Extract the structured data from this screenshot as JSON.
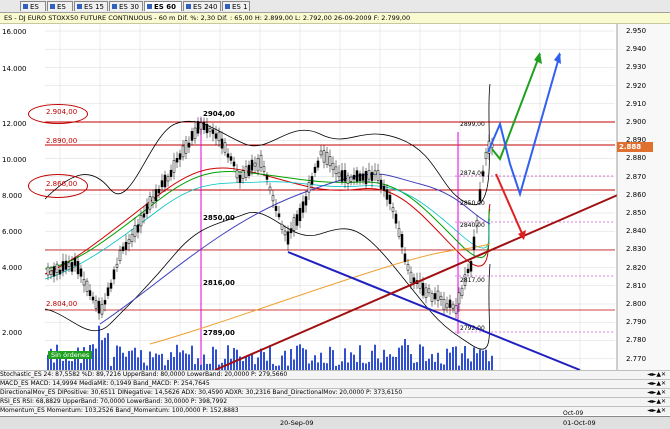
{
  "tabs": [
    {
      "label": "ES 1 m",
      "active": false
    },
    {
      "label": "ES 5 m",
      "active": false
    },
    {
      "label": "ES 15 m",
      "active": false
    },
    {
      "label": "ES 30 m",
      "active": false
    },
    {
      "label": "ES 60 m",
      "active": true
    },
    {
      "label": "ES 240 m",
      "active": false
    },
    {
      "label": "ES 1 D",
      "active": false
    }
  ],
  "infobar": {
    "text": "ES - DJ EURO STOXX50 FUTURE CONTINUOUS - 60 m  Dif. %: 2,30  Dif. : 65,00  H: 2.899,00  L: 2.792,00  26-09-2009  F: 2.799,00"
  },
  "price_axis": [
    "2.950",
    "2.940",
    "2.930",
    "2.920",
    "2.910",
    "2.900",
    "2.890",
    "2.880",
    "2.870",
    "2.860",
    "2.850",
    "2.840",
    "2.830",
    "2.820",
    "2.810",
    "2.800",
    "2.790",
    "2.780",
    "2.770"
  ],
  "stoch_axis": [
    "16.000",
    "14.000",
    "12.000",
    "10.000",
    "8.000",
    "6.000",
    "4.000",
    "2.000"
  ],
  "levels": [
    {
      "label": "2.904,00",
      "circled": true
    },
    {
      "label": "2.890,00",
      "circled": false
    },
    {
      "label": "2.866,00",
      "circled": true
    },
    {
      "label": "2.804,00",
      "circled": false
    }
  ],
  "annotations": [
    "2904,00",
    "2850,00",
    "2816,00",
    "2789,00",
    "2899,00",
    "2874,00",
    "2850,00",
    "2840,00",
    "2817,00",
    "2792,00"
  ],
  "current_price": "2.888",
  "sin_ordenes": "Sin órdenes",
  "indicators": [
    "Stochastic_ES 24: 87,5582 %D: 89,7216 UpperBand: 80,0000 LowerBand: 20,0000 P: 279,5660",
    "MACD_ES MACD: 14,9994 MediaMit: 0,1949 Band_MACD: P: 254,7645",
    "DirectionalMov_ES DIPositive: 30,6511 DINegative: 14,5626 ADX: 30,4590 ADXR: 30,2316 Band_DirectionalMov: 20,0000 P: 373,6150",
    "RSI_ES RSI: 68,8829 UpperBand: 70,0000 LowerBand: 30,0000 P: 398,7992",
    "Momentum_ES Momentum: 103,2526 Band_Momentum: 100,0000 P: 152,8883"
  ],
  "dates": [
    "20-Sep-09",
    "01-Oct-09"
  ],
  "date_mid": "Oct-09"
}
